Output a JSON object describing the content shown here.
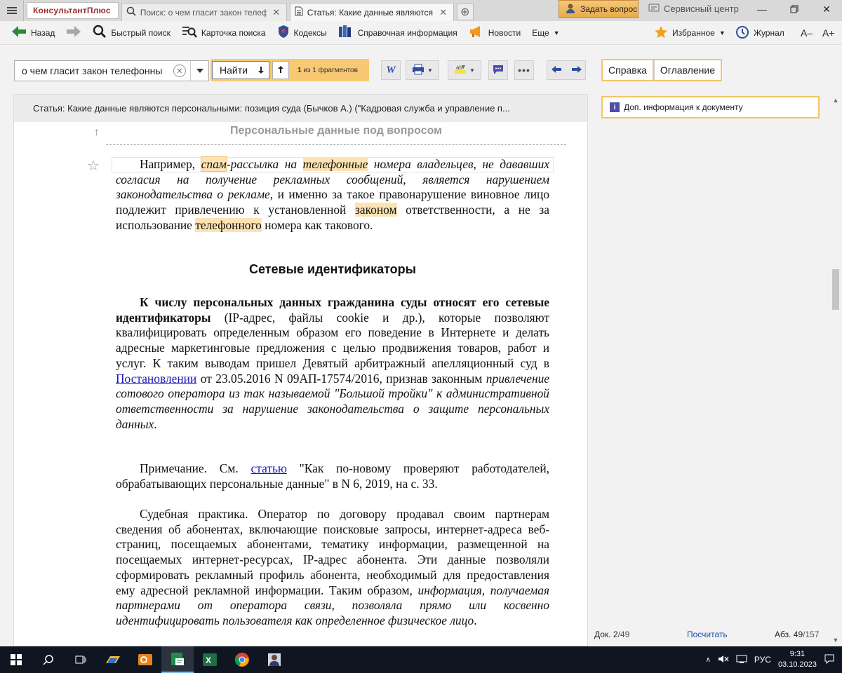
{
  "tabbar": {
    "brand": "КонсультантПлюс",
    "tabs": [
      {
        "label": "Поиск: о чем гласит закон телефонны",
        "active": false
      },
      {
        "label": "Статья: Какие данные являются персо",
        "active": true
      }
    ],
    "ask_question": "Задать вопрос",
    "service_center": "Сервисный центр"
  },
  "toolbar": {
    "back": "Назад",
    "quick_search": "Быстрый поиск",
    "search_card": "Карточка поиска",
    "codes": "Кодексы",
    "reference": "Справочная информация",
    "news": "Новости",
    "more": "Еще",
    "favorites": "Избранное",
    "journal": "Журнал",
    "font_decrease": "A–",
    "font_increase": "A+"
  },
  "search": {
    "query": "о чем гласит закон телефонны",
    "find_label": "Найти",
    "fragments_count": "1",
    "fragments_text": "из 1 фрагментов"
  },
  "right_tabs": {
    "help": "Справка",
    "contents": "Оглавление"
  },
  "doc_header": "Статья: Какие данные являются персональными: позиция суда (Бычков А.) (\"Кадровая служба и управление п...",
  "side_info": "Доп. информация к документу",
  "document": {
    "section_title": "Персональные данные под вопросом",
    "p1": {
      "a": "Например, ",
      "b": "спам",
      "c": "-рассылка на ",
      "d": "телефонные",
      "e": " номера владельцев, не дававших согласия на получение рекламных сообщений, является нарушением законодательства о рекламе",
      "f": ", и именно за такое правонарушение виновное лицо подлежит привлечению к установленной ",
      "g": "законом",
      "h": " ответственности, а не за использование ",
      "i": "телефонного",
      "j": " номера как такового."
    },
    "heading": "Сетевые идентификаторы",
    "p2": {
      "bold": "К числу персональных данных гражданина суды относят его сетевые идентификаторы",
      "a": " (IP-адрес, файлы cookie и др.), которые позволяют квалифицировать определенным образом его поведение в Интернете и делать адресные маркетинговые предложения с целью продвижения товаров, работ и услуг. К таким выводам пришел Девятый арбитражный апелляционный суд в ",
      "link": "Постановлении",
      "b": " от 23.05.2016 N 09АП-17574/2016, признав законным ",
      "italic": "привлечение сотового оператора из так называемой \"Большой тройки\" к административной ответственности за нарушение законодательства о защите персональных данных",
      "c": "."
    },
    "p3": {
      "a": "Примечание. См. ",
      "link": "статью",
      "b": " \"Как по-новому проверяют работодателей, обрабатывающих персональные данные\" в N 6, 2019, на с. 33."
    },
    "p4": {
      "a": "Судебная практика. Оператор по договору продавал своим партнерам сведения об абонентах, включающие поисковые запросы, интернет-адреса веб-страниц, посещаемых абонентами, тематику информации, размещенной на посещаемых интернет-ресурсах, IP-адрес абонента. Эти данные позволяли сформировать рекламный профиль абонента, необходимый для предоставления ему адресной рекламной информации. Таким образом, ",
      "italic": "информация, получаемая партнерами от оператора связи, позволяла прямо или косвенно идентифицировать пользователя как определенное физическое лицо",
      "b": "."
    }
  },
  "status": {
    "doc_label": "Док.",
    "doc_current": "2",
    "doc_total": "/49",
    "count_link": "Посчитать",
    "par_label": "Абз.",
    "par_current": "49",
    "par_total": "/157"
  },
  "taskbar": {
    "lang": "РУС",
    "time": "9:31",
    "date": "03.10.2023"
  },
  "colors": {
    "highlight": "#fde3b3",
    "accent": "#f4c469",
    "link": "#1a1ab3"
  }
}
